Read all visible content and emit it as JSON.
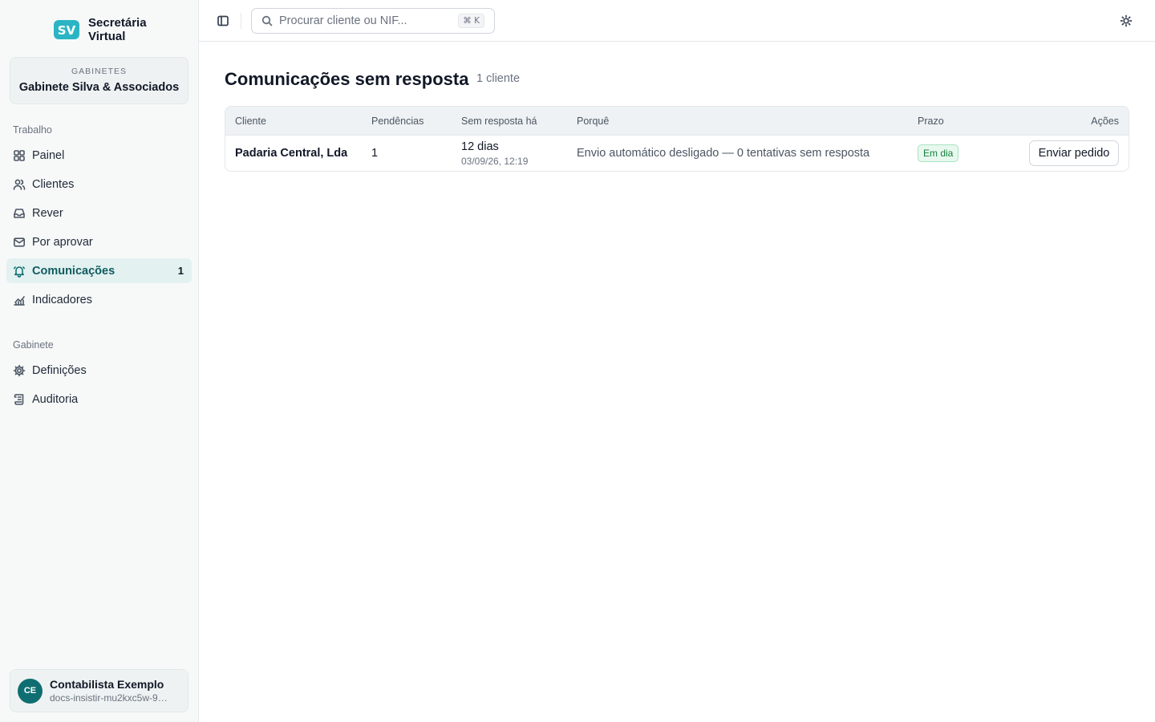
{
  "brand": {
    "name": "Secretária Virtual",
    "logo_text": "SV"
  },
  "office": {
    "label": "GABINETES",
    "name": "Gabinete Silva & Associados"
  },
  "sidebar": {
    "sections": [
      {
        "label": "Trabalho",
        "items": [
          {
            "label": "Painel",
            "icon": "grid-icon"
          },
          {
            "label": "Clientes",
            "icon": "users-icon"
          },
          {
            "label": "Rever",
            "icon": "inbox-icon"
          },
          {
            "label": "Por aprovar",
            "icon": "mail-icon"
          },
          {
            "label": "Comunicações",
            "icon": "bell-icon",
            "count": "1",
            "active": true
          },
          {
            "label": "Indicadores",
            "icon": "chart-icon"
          }
        ]
      },
      {
        "label": "Gabinete",
        "items": [
          {
            "label": "Definições",
            "icon": "gear-icon"
          },
          {
            "label": "Auditoria",
            "icon": "scroll-icon"
          }
        ]
      }
    ]
  },
  "user": {
    "initials": "CE",
    "name": "Contabilista Exemplo",
    "email": "docs-insistir-mu2kxc5w-9…"
  },
  "topbar": {
    "search": {
      "placeholder": "Procurar cliente ou NIF...",
      "value": "",
      "shortcut": "⌘ K"
    }
  },
  "main": {
    "title": "Comunicações sem resposta",
    "count": "1 cliente",
    "table": {
      "columns": [
        "Cliente",
        "Pendências",
        "Sem resposta há",
        "Porquê",
        "Prazo",
        "Ações"
      ],
      "rows": [
        {
          "client": "Padaria Central, Lda",
          "pending": "1",
          "since": "12 dias",
          "since_date": "03/09/26, 12:19",
          "reason": "Envio automático desligado — 0 tentativas sem resposta",
          "deadline": "Em dia",
          "action": "Enviar pedido"
        }
      ]
    }
  },
  "colors": {
    "accent": "#0f6e72",
    "active_bg": "#e3f1f1",
    "badge_green": "#15803d"
  }
}
